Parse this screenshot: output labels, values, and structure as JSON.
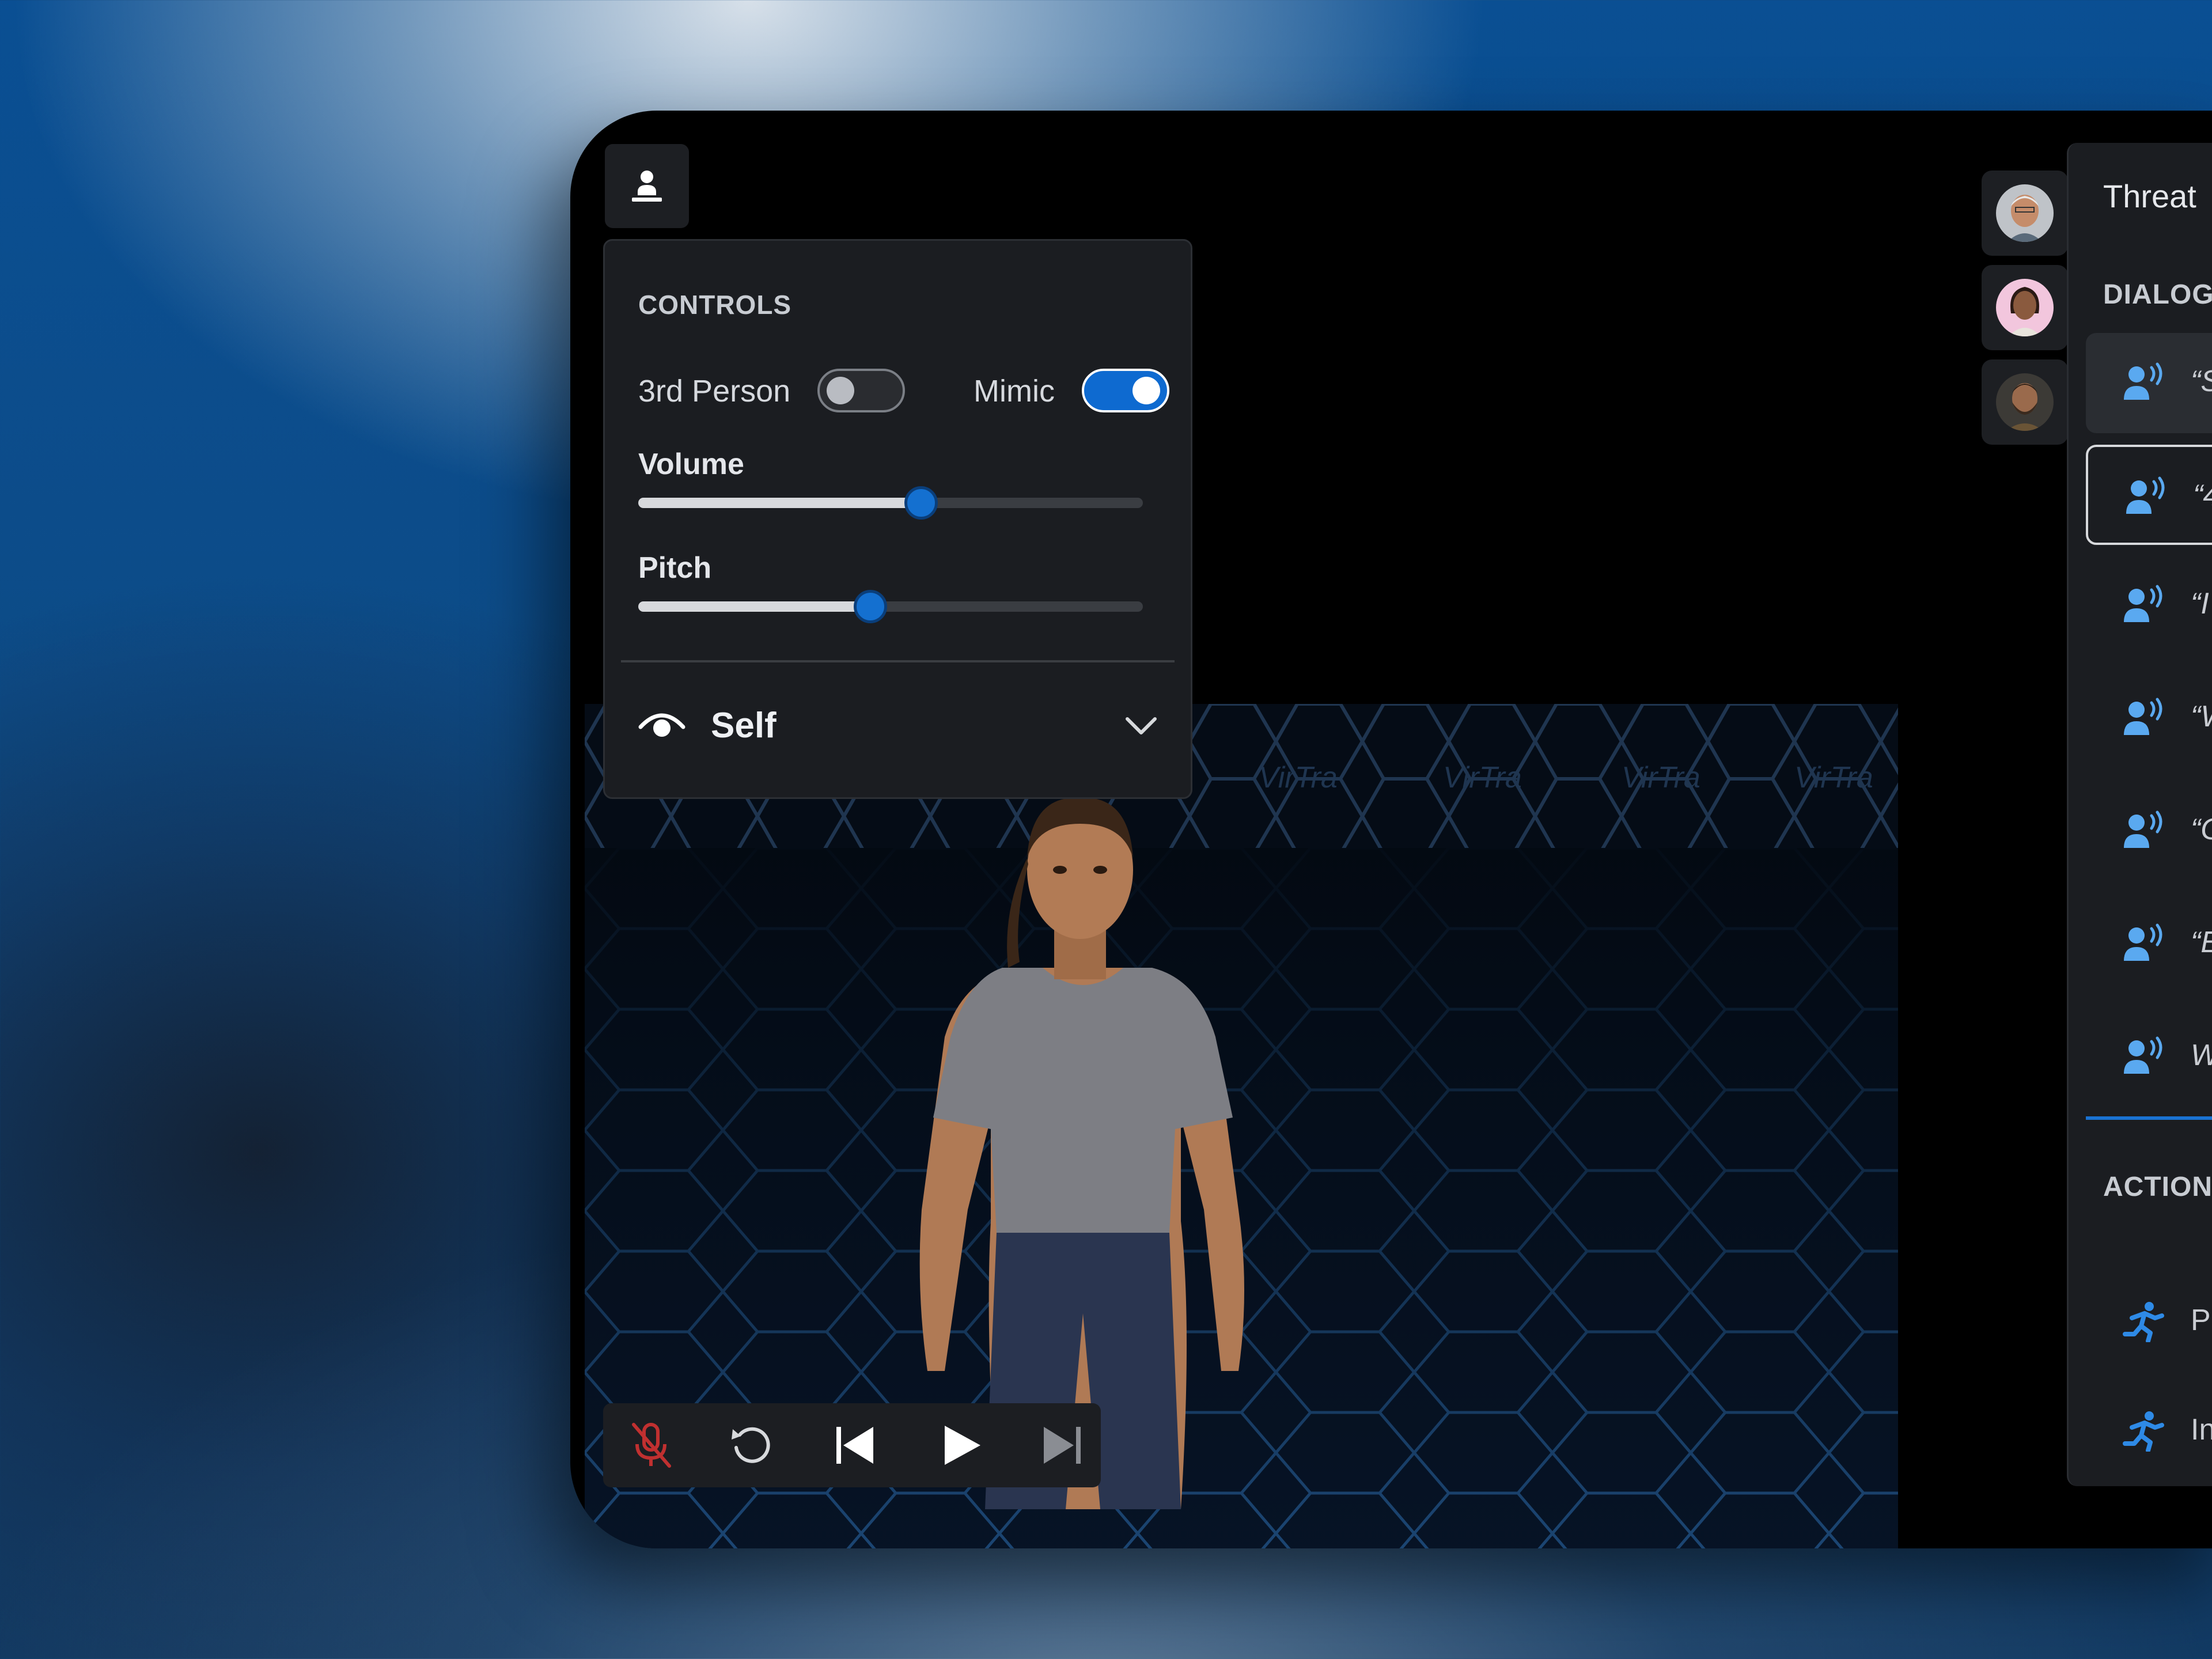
{
  "colors": {
    "accent": "#1470d0",
    "panel_bg": "#1b1d21",
    "muted_icon": "#8a8d93",
    "mic_muted": "#c03030",
    "dialog_icon": "#5aa9f0"
  },
  "header_button": {
    "icon": "person-icon"
  },
  "controls": {
    "title": "CONTROLS",
    "third_person": {
      "label": "3rd Person",
      "on": false
    },
    "mimic": {
      "label": "Mimic",
      "on": true
    },
    "volume": {
      "label": "Volume",
      "value": 0.56
    },
    "pitch": {
      "label": "Pitch",
      "value": 0.46
    },
    "view": {
      "icon": "eye-icon",
      "label": "Self",
      "chevron": "chevron-down-icon"
    }
  },
  "scene": {
    "wall_text": "VirTra"
  },
  "transport": {
    "buttons": [
      {
        "name": "mic-muted-icon"
      },
      {
        "name": "replay-icon"
      },
      {
        "name": "skip-back-icon"
      },
      {
        "name": "play-icon"
      },
      {
        "name": "skip-forward-icon"
      }
    ]
  },
  "avatars": [
    {
      "name": "avatar-older-man"
    },
    {
      "name": "avatar-woman"
    },
    {
      "name": "avatar-bearded-man"
    }
  ],
  "right_panel": {
    "title": "Threat",
    "dialog_section": "DIALOG",
    "dialog_items": [
      {
        "text": "“S",
        "state": "active"
      },
      {
        "text": "“4",
        "state": "selected"
      },
      {
        "text": "“I",
        "state": "normal"
      },
      {
        "text": "“W",
        "state": "normal"
      },
      {
        "text": "“G",
        "state": "normal"
      },
      {
        "text": "“E",
        "state": "normal"
      },
      {
        "text": "W",
        "state": "normal"
      }
    ],
    "action_section": "ACTION",
    "action_items": [
      {
        "text": "Pu",
        "icon": "running-person-icon"
      },
      {
        "text": "In",
        "icon": "running-person-icon"
      }
    ]
  }
}
